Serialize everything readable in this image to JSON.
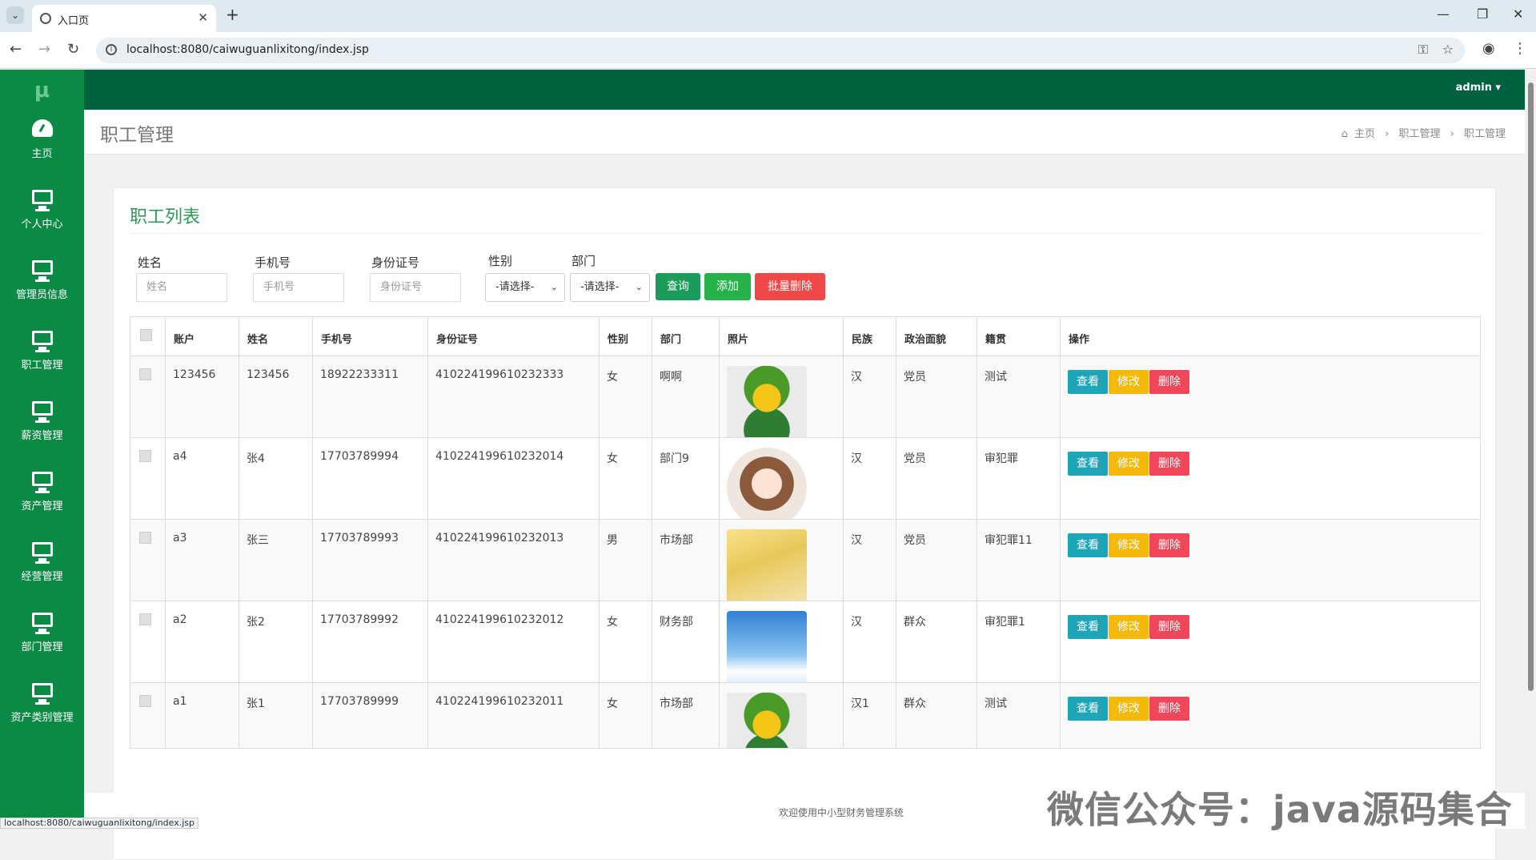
{
  "browser": {
    "tab_title": "入口页",
    "url": "localhost:8080/caiwuguanlixitong/index.jsp",
    "status_url": "localhost:8080/caiwuguanlixitong/index.jsp"
  },
  "sidebar": {
    "logo": "μ",
    "items": [
      {
        "label": "主页",
        "icon": "dashboard-icon"
      },
      {
        "label": "个人中心",
        "icon": "monitor-icon"
      },
      {
        "label": "管理员信息",
        "icon": "monitor-icon"
      },
      {
        "label": "职工管理",
        "icon": "monitor-icon"
      },
      {
        "label": "薪资管理",
        "icon": "monitor-icon"
      },
      {
        "label": "资产管理",
        "icon": "monitor-icon"
      },
      {
        "label": "经营管理",
        "icon": "monitor-icon"
      },
      {
        "label": "部门管理",
        "icon": "monitor-icon"
      },
      {
        "label": "资产类别管理",
        "icon": "monitor-icon"
      }
    ]
  },
  "header": {
    "user": "admin ▾"
  },
  "page": {
    "title": "职工管理",
    "breadcrumb": [
      "主页",
      "职工管理",
      "职工管理"
    ]
  },
  "list": {
    "title": "职工列表",
    "filters": {
      "name_label": "姓名",
      "name_placeholder": "姓名",
      "phone_label": "手机号",
      "phone_placeholder": "手机号",
      "id_label": "身份证号",
      "id_placeholder": "身份证号",
      "gender_label": "性别",
      "gender_value": "-请选择-",
      "dept_label": "部门",
      "dept_value": "-请选择-"
    },
    "buttons": {
      "search": "查询",
      "add": "添加",
      "batch_delete": "批量删除"
    },
    "columns": [
      "账户",
      "姓名",
      "手机号",
      "身份证号",
      "性别",
      "部门",
      "照片",
      "民族",
      "政治面貌",
      "籍贯",
      "操作"
    ],
    "rows": [
      {
        "account": "123456",
        "name": "123456",
        "phone": "18922233311",
        "idcard": "410224199610232333",
        "gender": "女",
        "dept": "啊啊",
        "photo": "cartoon-link",
        "ethnic": "汉",
        "political": "党员",
        "hometown": "测试"
      },
      {
        "account": "a4",
        "name": "张4",
        "phone": "17703789994",
        "idcard": "410224199610232014",
        "gender": "女",
        "dept": "部门9",
        "photo": "girl-portrait",
        "ethnic": "汉",
        "political": "党员",
        "hometown": "审犯罪"
      },
      {
        "account": "a3",
        "name": "张三",
        "phone": "17703789993",
        "idcard": "410224199610232013",
        "gender": "男",
        "dept": "市场部",
        "photo": "anime-girl",
        "ethnic": "汉",
        "political": "党员",
        "hometown": "审犯罪11"
      },
      {
        "account": "a2",
        "name": "张2",
        "phone": "17703789992",
        "idcard": "410224199610232012",
        "gender": "女",
        "dept": "财务部",
        "photo": "boy-sky",
        "ethnic": "汉",
        "political": "群众",
        "hometown": "审犯罪1"
      },
      {
        "account": "a1",
        "name": "张1",
        "phone": "17703789999",
        "idcard": "410224199610232011",
        "gender": "女",
        "dept": "市场部",
        "photo": "cartoon-link",
        "ethnic": "汉1",
        "political": "群众",
        "hometown": "测试"
      }
    ],
    "actions": {
      "view": "查看",
      "edit": "修改",
      "delete": "删除"
    }
  },
  "footer": {
    "text": "欢迎使用中小型财务管理系统"
  },
  "watermark": "微信公众号：java源码集合",
  "colors": {
    "sidebar": "#0b8a45",
    "topbar": "#00613f",
    "view": "#1fa5b8",
    "edit": "#f5b90c",
    "delete": "#f0475a",
    "search": "#1b9c5a",
    "add": "#26b14a",
    "batch": "#f04848"
  }
}
